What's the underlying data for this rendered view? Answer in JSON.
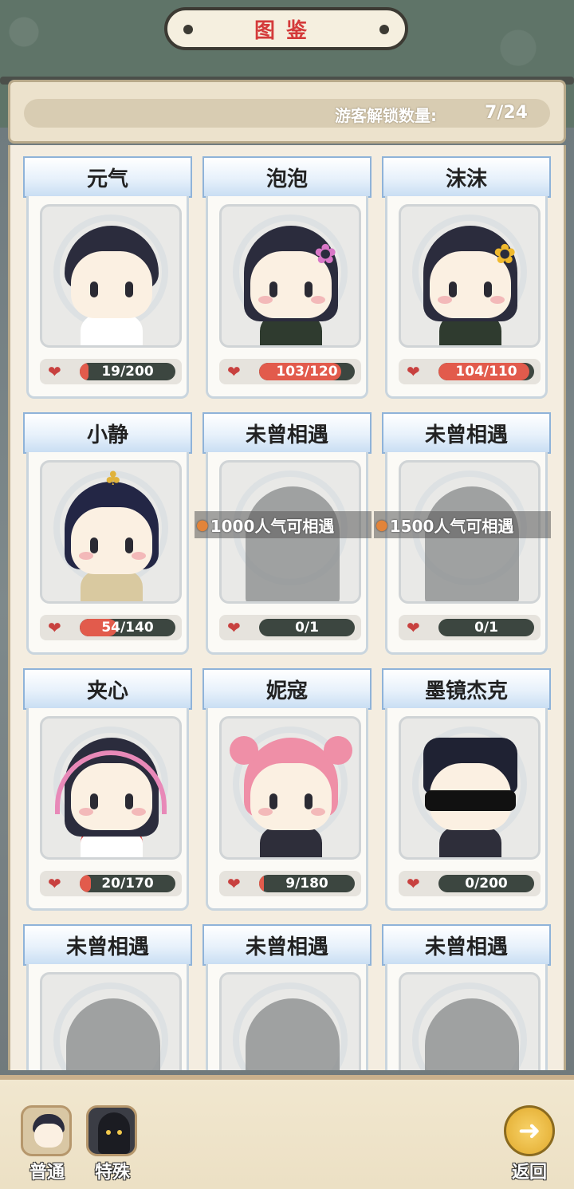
{
  "header": {
    "title": "图鉴"
  },
  "summary": {
    "label": "游客解锁数量:",
    "value": "7/24",
    "unlocked": 7,
    "total": 24
  },
  "cards": [
    {
      "name": "元气",
      "status": "unlocked",
      "progress_text": "19/200",
      "progress": 0.095
    },
    {
      "name": "泡泡",
      "status": "unlocked",
      "progress_text": "103/120",
      "progress": 0.86
    },
    {
      "name": "沫沫",
      "status": "unlocked",
      "progress_text": "104/110",
      "progress": 0.95
    },
    {
      "name": "小静",
      "status": "unlocked",
      "progress_text": "54/140",
      "progress": 0.39
    },
    {
      "name": "未曾相遇",
      "status": "locked",
      "unlock_text": "1000人气可相遇",
      "progress_text": "0/1",
      "progress": 0
    },
    {
      "name": "未曾相遇",
      "status": "locked",
      "unlock_text": "1500人气可相遇",
      "progress_text": "0/1",
      "progress": 0
    },
    {
      "name": "夹心",
      "status": "unlocked",
      "progress_text": "20/170",
      "progress": 0.12
    },
    {
      "name": "妮寇",
      "status": "unlocked",
      "progress_text": "9/180",
      "progress": 0.05
    },
    {
      "name": "墨镜杰克",
      "status": "unlocked",
      "progress_text": "0/200",
      "progress": 0
    },
    {
      "name": "未曾相遇",
      "status": "locked"
    },
    {
      "name": "未曾相遇",
      "status": "locked"
    },
    {
      "name": "未曾相遇",
      "status": "locked"
    }
  ],
  "tabs": [
    {
      "label": "普通",
      "icon": "boy-avatar-icon"
    },
    {
      "label": "特殊",
      "icon": "hooded-figure-icon"
    }
  ],
  "back": {
    "label": "返回",
    "icon": "arrow-right-circle-icon"
  },
  "colors": {
    "title_red": "#d43a3a",
    "bar_fill": "#e25b4c",
    "bar_track": "#3c4640",
    "header_blue": "#c9def3"
  }
}
